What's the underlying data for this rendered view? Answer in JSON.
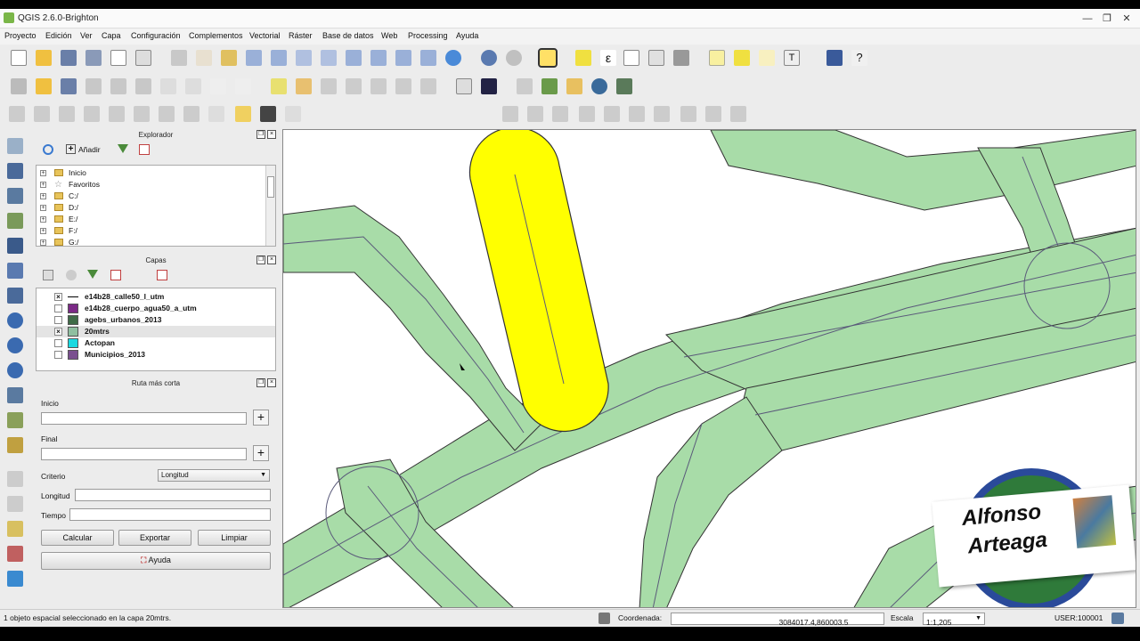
{
  "window": {
    "title": "QGIS 2.6.0-Brighton",
    "minimize": "—",
    "restore": "❐",
    "close": "✕"
  },
  "menu": [
    "Proyecto",
    "Edición",
    "Ver",
    "Capa",
    "Configuración",
    "Complementos",
    "Vectorial",
    "Ráster",
    "Base de datos",
    "Web",
    "Processing",
    "Ayuda"
  ],
  "browser": {
    "title": "Explorador",
    "add_label": "Añadir",
    "items": [
      "Inicio",
      "Favoritos",
      "C:/",
      "D:/",
      "E:/",
      "F:/",
      "G:/"
    ]
  },
  "layers": {
    "title": "Capas",
    "items": [
      {
        "name": "e14b28_calle50_l_utm",
        "checked": true,
        "color": "#000000",
        "symbol": "line"
      },
      {
        "name": "e14b28_cuerpo_agua50_a_utm",
        "checked": false,
        "color": "#7b2a86",
        "symbol": "fill"
      },
      {
        "name": "agebs_urbanos_2013",
        "checked": false,
        "color": "#3f6b47",
        "symbol": "fill"
      },
      {
        "name": "20mtrs",
        "checked": true,
        "color": "#8fbfa0",
        "symbol": "fill"
      },
      {
        "name": "Actopan",
        "checked": false,
        "color": "#19d9e0",
        "symbol": "fill"
      },
      {
        "name": "Municipios_2013",
        "checked": false,
        "color": "#7a4f8f",
        "symbol": "fill"
      }
    ],
    "check_mark": "×"
  },
  "route": {
    "title": "Ruta más corta",
    "start_label": "Inicio",
    "end_label": "Final",
    "criteria_label": "Criterio",
    "criteria_value": "Longitud",
    "length_label": "Longitud",
    "time_label": "Tiempo",
    "calc_button": "Calcular",
    "export_button": "Exportar",
    "clear_button": "Limpiar",
    "help_button": "Ayuda",
    "plus": "+"
  },
  "status": {
    "message": "1 objeto espacial seleccionado en la capa 20mtrs.",
    "coord_label": "Coordenada:",
    "coord_value": "3084017.4,860003.5",
    "scale_label": "Escala",
    "scale_value": "1:1,205",
    "crs": "USER:100001"
  },
  "watermark": {
    "line1": "Alfonso",
    "line2": "Arteaga"
  },
  "colors": {
    "buffer": "#a8dca8",
    "selected": "#ffff00",
    "outline": "#333333"
  }
}
